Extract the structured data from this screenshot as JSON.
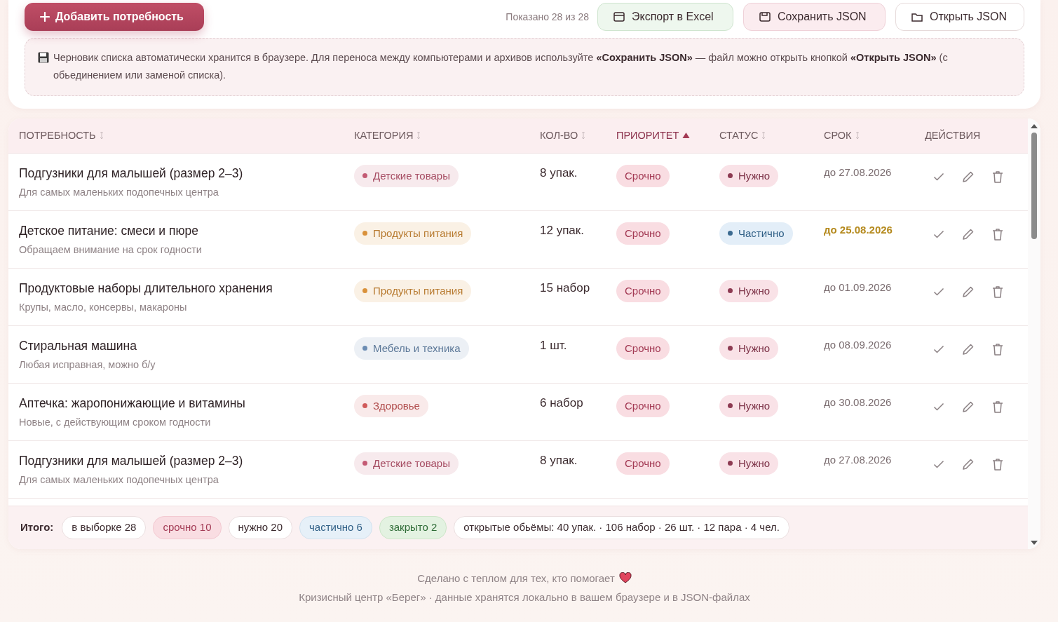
{
  "toolbar": {
    "add_button": "Добавить потребность",
    "shown": "Показано 28 из 28",
    "buttons": [
      {
        "label": "Экспорт в Excel",
        "kind": "excel"
      },
      {
        "label": "Сохранить JSON",
        "kind": "save"
      },
      {
        "label": "Открыть JSON",
        "kind": "open"
      }
    ]
  },
  "note": "Черновик списка автоматически хранится в браузере. Для переноса между компьютерами и архивов используйте **«Сохранить JSON»** — файл можно открыть кнопкой **«Открыть JSON»** (с обьединением или заменой списка).",
  "table": {
    "columns": [
      {
        "label": "ПОТРЕБНОСТЬ",
        "sorted": false
      },
      {
        "label": "КАТЕГОРИЯ",
        "sorted": false
      },
      {
        "label": "КОЛ-ВО",
        "sorted": false
      },
      {
        "label": "ПРИОРИТЕТ",
        "sorted": true
      },
      {
        "label": "СТАТУС",
        "sorted": false
      },
      {
        "label": "СРОК",
        "sorted": false
      },
      {
        "label": "ДЕЙСТВИЯ"
      }
    ],
    "rows": [
      {
        "name": "Подгузники для малышей (размер 2–3)",
        "note": "Для самых маленьких подопечных центра",
        "category": {
          "label": "Детские товары",
          "color": "#c35a74"
        },
        "quantity": "8 упак.",
        "priority": {
          "label": "Срочно",
          "kind": "urgent"
        },
        "status": {
          "label": "Нужно",
          "kind": "needed"
        },
        "due": "до 27.08.2026",
        "due_soon": false
      },
      {
        "name": "Детское питание: смеси и пюре",
        "note": "Обращаем внимание на срок годности",
        "category": {
          "label": "Продукты питания",
          "color": "#d9913a"
        },
        "quantity": "12 упак.",
        "priority": {
          "label": "Срочно",
          "kind": "urgent"
        },
        "status": {
          "label": "Частично",
          "kind": "partial"
        },
        "due": "до 25.08.2026",
        "due_soon": true
      },
      {
        "name": "Продуктовые наборы длительного хранения",
        "note": "Крупы, масло, консервы, макароны",
        "category": {
          "label": "Продукты питания",
          "color": "#d9913a"
        },
        "quantity": "15 набор",
        "priority": {
          "label": "Срочно",
          "kind": "urgent"
        },
        "status": {
          "label": "Нужно",
          "kind": "needed"
        },
        "due": "до 01.09.2026",
        "due_soon": false
      },
      {
        "name": "Стиральная машина",
        "note": "Любая исправная, можно б/у",
        "category": {
          "label": "Мебель и техника",
          "color": "#6c8db3"
        },
        "quantity": "1 шт.",
        "priority": {
          "label": "Срочно",
          "kind": "urgent"
        },
        "status": {
          "label": "Нужно",
          "kind": "needed"
        },
        "due": "до 08.09.2026",
        "due_soon": false
      },
      {
        "name": "Аптечка: жаропонижающие и витамины",
        "note": "Новые, с действующим сроком годности",
        "category": {
          "label": "Здоровье",
          "color": "#d05a5a"
        },
        "quantity": "6 набор",
        "priority": {
          "label": "Срочно",
          "kind": "urgent"
        },
        "status": {
          "label": "Нужно",
          "kind": "needed"
        },
        "due": "до 30.08.2026",
        "due_soon": false
      },
      {
        "name": "Подгузники для малышей (размер 2–3)",
        "note": "Для самых маленьких подопечных центра",
        "category": {
          "label": "Детские товары",
          "color": "#c35a74"
        },
        "quantity": "8 упак.",
        "priority": {
          "label": "Срочно",
          "kind": "urgent"
        },
        "status": {
          "label": "Нужно",
          "kind": "needed"
        },
        "due": "до 27.08.2026",
        "due_soon": false
      }
    ]
  },
  "totals": {
    "label": "Итого:",
    "chips": [
      {
        "text": "в выборке 28",
        "kind": "plain"
      },
      {
        "text": "срочно 10",
        "kind": "urgent"
      },
      {
        "text": "нужно 20",
        "kind": "plain"
      },
      {
        "text": "частично 6",
        "kind": "partial"
      },
      {
        "text": "закрыто 2",
        "kind": "closed"
      },
      {
        "text": "открытые обьёмы: 40 упак. · 106 набор · 26 шт. · 12 пара · 4 чел.",
        "kind": "plain"
      }
    ]
  },
  "footer": {
    "line_1": "Сделано с теплом для тех, кто помогает",
    "line_2": "Кризисный центр «Берег» · данные хранятся локально в вашем браузере и в JSON-файлах"
  }
}
